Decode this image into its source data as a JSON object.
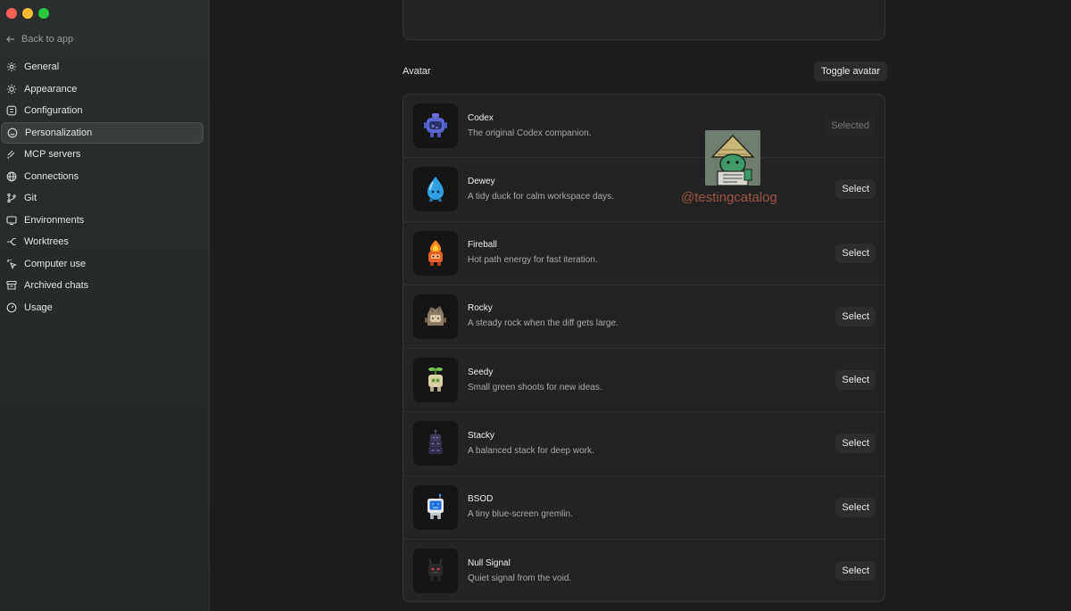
{
  "window": {
    "controls": [
      "close",
      "minimize",
      "zoom"
    ]
  },
  "sidebar": {
    "back_label": "Back to app",
    "items": [
      {
        "label": "General",
        "icon": "gear-icon"
      },
      {
        "label": "Appearance",
        "icon": "sun-icon"
      },
      {
        "label": "Configuration",
        "icon": "sliders-icon"
      },
      {
        "label": "Personalization",
        "icon": "smile-icon",
        "active": true
      },
      {
        "label": "MCP servers",
        "icon": "plug-icon"
      },
      {
        "label": "Connections",
        "icon": "globe-icon"
      },
      {
        "label": "Git",
        "icon": "branch-icon"
      },
      {
        "label": "Environments",
        "icon": "monitor-icon"
      },
      {
        "label": "Worktrees",
        "icon": "fork-icon"
      },
      {
        "label": "Computer use",
        "icon": "cursor-icon"
      },
      {
        "label": "Archived chats",
        "icon": "archive-icon"
      },
      {
        "label": "Usage",
        "icon": "gauge-icon"
      }
    ]
  },
  "main": {
    "section_title": "Avatar",
    "toggle_label": "Toggle avatar",
    "avatars": [
      {
        "name": "Codex",
        "desc": "The original Codex companion.",
        "button": "Selected",
        "selected": true,
        "icon": "codex-avatar-icon"
      },
      {
        "name": "Dewey",
        "desc": "A tidy duck for calm workspace days.",
        "button": "Select",
        "selected": false,
        "icon": "dewey-avatar-icon"
      },
      {
        "name": "Fireball",
        "desc": "Hot path energy for fast iteration.",
        "button": "Select",
        "selected": false,
        "icon": "fireball-avatar-icon"
      },
      {
        "name": "Rocky",
        "desc": "A steady rock when the diff gets large.",
        "button": "Select",
        "selected": false,
        "icon": "rocky-avatar-icon"
      },
      {
        "name": "Seedy",
        "desc": "Small green shoots for new ideas.",
        "button": "Select",
        "selected": false,
        "icon": "seedy-avatar-icon"
      },
      {
        "name": "Stacky",
        "desc": "A balanced stack for deep work.",
        "button": "Select",
        "selected": false,
        "icon": "stacky-avatar-icon"
      },
      {
        "name": "BSOD",
        "desc": "A tiny blue-screen gremlin.",
        "button": "Select",
        "selected": false,
        "icon": "bsod-avatar-icon"
      },
      {
        "name": "Null Signal",
        "desc": "Quiet signal from the void.",
        "button": "Select",
        "selected": false,
        "icon": "null-signal-avatar-icon"
      }
    ]
  },
  "watermark": {
    "text": "@testingcatalog"
  },
  "colors": {
    "background": "#1c1c1c",
    "sidebar": "#262a2a",
    "card": "#232323",
    "watermark": "#b25b4a"
  }
}
